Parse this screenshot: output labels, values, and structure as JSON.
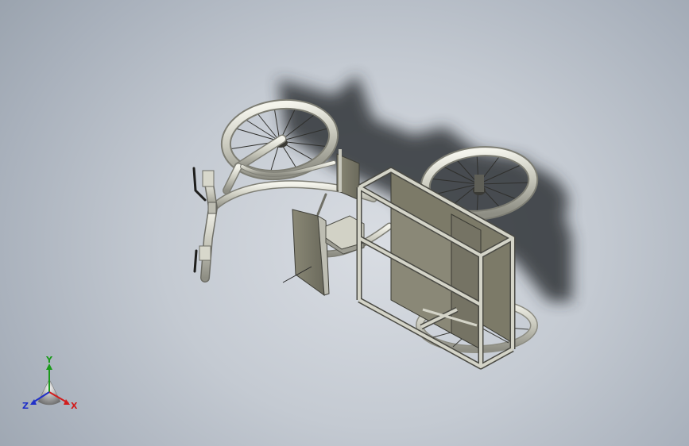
{
  "viewport": {
    "background_center": "#d9dde3",
    "background_edge": "#9aa3ae"
  },
  "model": {
    "frame_color": "#c8c8bd",
    "panel_color": "#7a7868",
    "tire_color": "#d2d2c6",
    "shadow_color": "#2a2d33"
  },
  "triad": {
    "x_label": "X",
    "y_label": "Y",
    "z_label": "Z",
    "x_color": "#d11c1c",
    "y_color": "#1a9a1a",
    "z_color": "#2030c8"
  }
}
